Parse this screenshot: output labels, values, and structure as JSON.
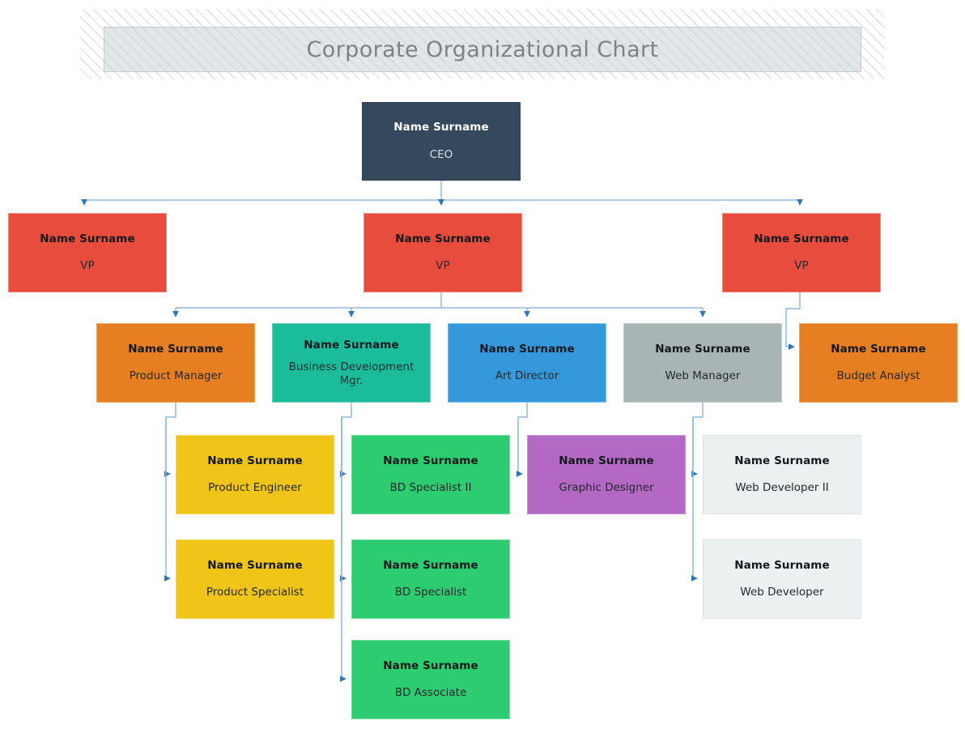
{
  "header": {
    "title": "Corporate Organizational Chart"
  },
  "colors": {
    "ceo": "#34495e",
    "vp": "#e74c3c",
    "orange": "#e67e22",
    "teal": "#1abc9c",
    "blue": "#3498db",
    "gray": "#a9b5b4",
    "yellow": "#f0c419",
    "green": "#2ecc71",
    "purple": "#b368c4",
    "light": "#ecf0f1",
    "connector": "#5b9bd5",
    "banner_text": "#7d8287"
  },
  "chart_data": {
    "type": "diagram",
    "title": "Corporate Organizational Chart",
    "nodes": [
      {
        "id": "ceo",
        "name": "Name Surname",
        "title": "CEO",
        "level": 0,
        "color": "#34495e",
        "parent": null
      },
      {
        "id": "vp1",
        "name": "Name Surname",
        "title": "VP",
        "level": 1,
        "color": "#e74c3c",
        "parent": "ceo"
      },
      {
        "id": "vp2",
        "name": "Name Surname",
        "title": "VP",
        "level": 1,
        "color": "#e74c3c",
        "parent": "ceo"
      },
      {
        "id": "vp3",
        "name": "Name Surname",
        "title": "VP",
        "level": 1,
        "color": "#e74c3c",
        "parent": "ceo"
      },
      {
        "id": "pm",
        "name": "Name Surname",
        "title": "Product Manager",
        "level": 2,
        "color": "#e67e22",
        "parent": "vp2"
      },
      {
        "id": "bdm",
        "name": "Name Surname",
        "title": "Business Development Mgr.",
        "level": 2,
        "color": "#1abc9c",
        "parent": "vp2"
      },
      {
        "id": "ad",
        "name": "Name Surname",
        "title": "Art Director",
        "level": 2,
        "color": "#3498db",
        "parent": "vp2"
      },
      {
        "id": "wm",
        "name": "Name Surname",
        "title": "Web Manager",
        "level": 2,
        "color": "#a9b5b4",
        "parent": "vp2"
      },
      {
        "id": "ba",
        "name": "Name Surname",
        "title": "Budget Analyst",
        "level": 2,
        "color": "#e67e22",
        "parent": "vp3"
      },
      {
        "id": "pe",
        "name": "Name Surname",
        "title": "Product Engineer",
        "level": 3,
        "color": "#f0c419",
        "parent": "pm"
      },
      {
        "id": "ps",
        "name": "Name Surname",
        "title": "Product Specialist",
        "level": 3,
        "color": "#f0c419",
        "parent": "pm"
      },
      {
        "id": "bds2",
        "name": "Name Surname",
        "title": "BD Specialist II",
        "level": 3,
        "color": "#2ecc71",
        "parent": "bdm"
      },
      {
        "id": "bds1",
        "name": "Name Surname",
        "title": "BD Specialist",
        "level": 3,
        "color": "#2ecc71",
        "parent": "bdm"
      },
      {
        "id": "bda",
        "name": "Name Surname",
        "title": "BD Associate",
        "level": 3,
        "color": "#2ecc71",
        "parent": "bdm"
      },
      {
        "id": "gd",
        "name": "Name Surname",
        "title": "Graphic Designer",
        "level": 3,
        "color": "#b368c4",
        "parent": "ad"
      },
      {
        "id": "wd2",
        "name": "Name Surname",
        "title": "Web Developer II",
        "level": 3,
        "color": "#ecf0f1",
        "parent": "wm"
      },
      {
        "id": "wd1",
        "name": "Name Surname",
        "title": "Web Developer",
        "level": 3,
        "color": "#ecf0f1",
        "parent": "wm"
      }
    ],
    "edges": [
      [
        "ceo",
        "vp1"
      ],
      [
        "ceo",
        "vp2"
      ],
      [
        "ceo",
        "vp3"
      ],
      [
        "vp2",
        "pm"
      ],
      [
        "vp2",
        "bdm"
      ],
      [
        "vp2",
        "ad"
      ],
      [
        "vp2",
        "wm"
      ],
      [
        "vp3",
        "ba"
      ],
      [
        "pm",
        "pe"
      ],
      [
        "pm",
        "ps"
      ],
      [
        "bdm",
        "bds2"
      ],
      [
        "bdm",
        "bds1"
      ],
      [
        "bdm",
        "bda"
      ],
      [
        "ad",
        "gd"
      ],
      [
        "wm",
        "wd2"
      ],
      [
        "wm",
        "wd1"
      ]
    ],
    "levels": 4,
    "orientation": "top-down"
  },
  "nodes": {
    "ceo": {
      "name": "Name Surname",
      "title": "CEO"
    },
    "vp1": {
      "name": "Name Surname",
      "title": "VP"
    },
    "vp2": {
      "name": "Name Surname",
      "title": "VP"
    },
    "vp3": {
      "name": "Name Surname",
      "title": "VP"
    },
    "pm": {
      "name": "Name Surname",
      "title": "Product Manager"
    },
    "bdm": {
      "name": "Name Surname",
      "title": "Business Development Mgr."
    },
    "ad": {
      "name": "Name Surname",
      "title": "Art Director"
    },
    "wm": {
      "name": "Name Surname",
      "title": "Web Manager"
    },
    "ba": {
      "name": "Name Surname",
      "title": "Budget Analyst"
    },
    "pe": {
      "name": "Name Surname",
      "title": "Product Engineer"
    },
    "ps": {
      "name": "Name Surname",
      "title": "Product Specialist"
    },
    "bds2": {
      "name": "Name Surname",
      "title": "BD Specialist II"
    },
    "bds1": {
      "name": "Name Surname",
      "title": "BD Specialist"
    },
    "bda": {
      "name": "Name Surname",
      "title": "BD Associate"
    },
    "gd": {
      "name": "Name Surname",
      "title": "Graphic Designer"
    },
    "wd2": {
      "name": "Name Surname",
      "title": "Web Developer II"
    },
    "wd1": {
      "name": "Name Surname",
      "title": "Web Developer"
    }
  }
}
